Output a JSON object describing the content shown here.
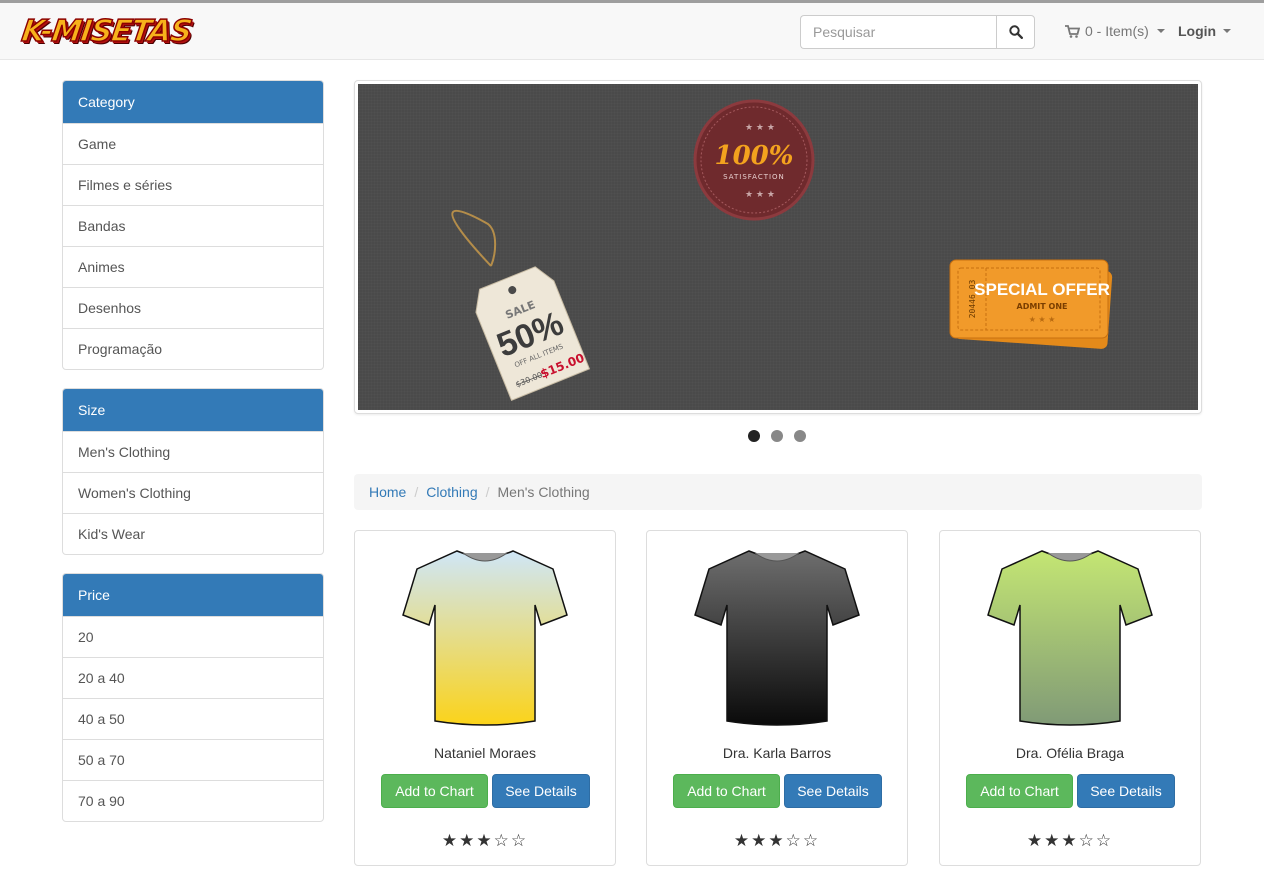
{
  "brand": {
    "name": "K-MISETAS"
  },
  "search": {
    "placeholder": "Pesquisar"
  },
  "cart": {
    "label": "0 - Item(s)"
  },
  "login": {
    "label": "Login"
  },
  "sidebar": {
    "category": {
      "title": "Category",
      "items": [
        "Game",
        "Filmes e séries",
        "Bandas",
        "Animes",
        "Desenhos",
        "Programação"
      ]
    },
    "size": {
      "title": "Size",
      "items": [
        "Men's Clothing",
        "Women's Clothing",
        "Kid's Wear"
      ]
    },
    "price": {
      "title": "Price",
      "items": [
        "20",
        "20 a 40",
        "40 a 50",
        "50 a 70",
        "70 a 90"
      ]
    }
  },
  "carousel": {
    "slide_count": 3,
    "active_index": 0,
    "badge": {
      "top": "100%",
      "bottom": "SATISFACTION"
    },
    "tag": {
      "line1": "SALE",
      "line2": "50%",
      "line3": "OFF ALL ITEMS",
      "old_price": "$30.00",
      "new_price": "$15.00"
    },
    "ticket": {
      "serial": "20446 03",
      "title": "SPECIAL OFFER",
      "subtitle": "ADMIT ONE"
    }
  },
  "breadcrumb": {
    "items": [
      "Home",
      "Clothing"
    ],
    "active": "Men's Clothing"
  },
  "products": [
    {
      "name": "Nataniel Moraes",
      "add_label": "Add to Chart",
      "details_label": "See Details",
      "stars": "★★★☆☆",
      "rating": 3,
      "colors": [
        "#cfe6f7",
        "#fbd31a"
      ]
    },
    {
      "name": "Dra. Karla Barros",
      "add_label": "Add to Chart",
      "details_label": "See Details",
      "stars": "★★★☆☆",
      "rating": 3,
      "colors": [
        "#6e6e6e",
        "#0a0a0a"
      ]
    },
    {
      "name": "Dra. Ofélia Braga",
      "add_label": "Add to Chart",
      "details_label": "See Details",
      "stars": "★★★☆☆",
      "rating": 3,
      "colors": [
        "#c4e673",
        "#809a76"
      ]
    }
  ],
  "colors": {
    "primary": "#337ab7",
    "success": "#5cb85c",
    "link": "#337ab7"
  }
}
